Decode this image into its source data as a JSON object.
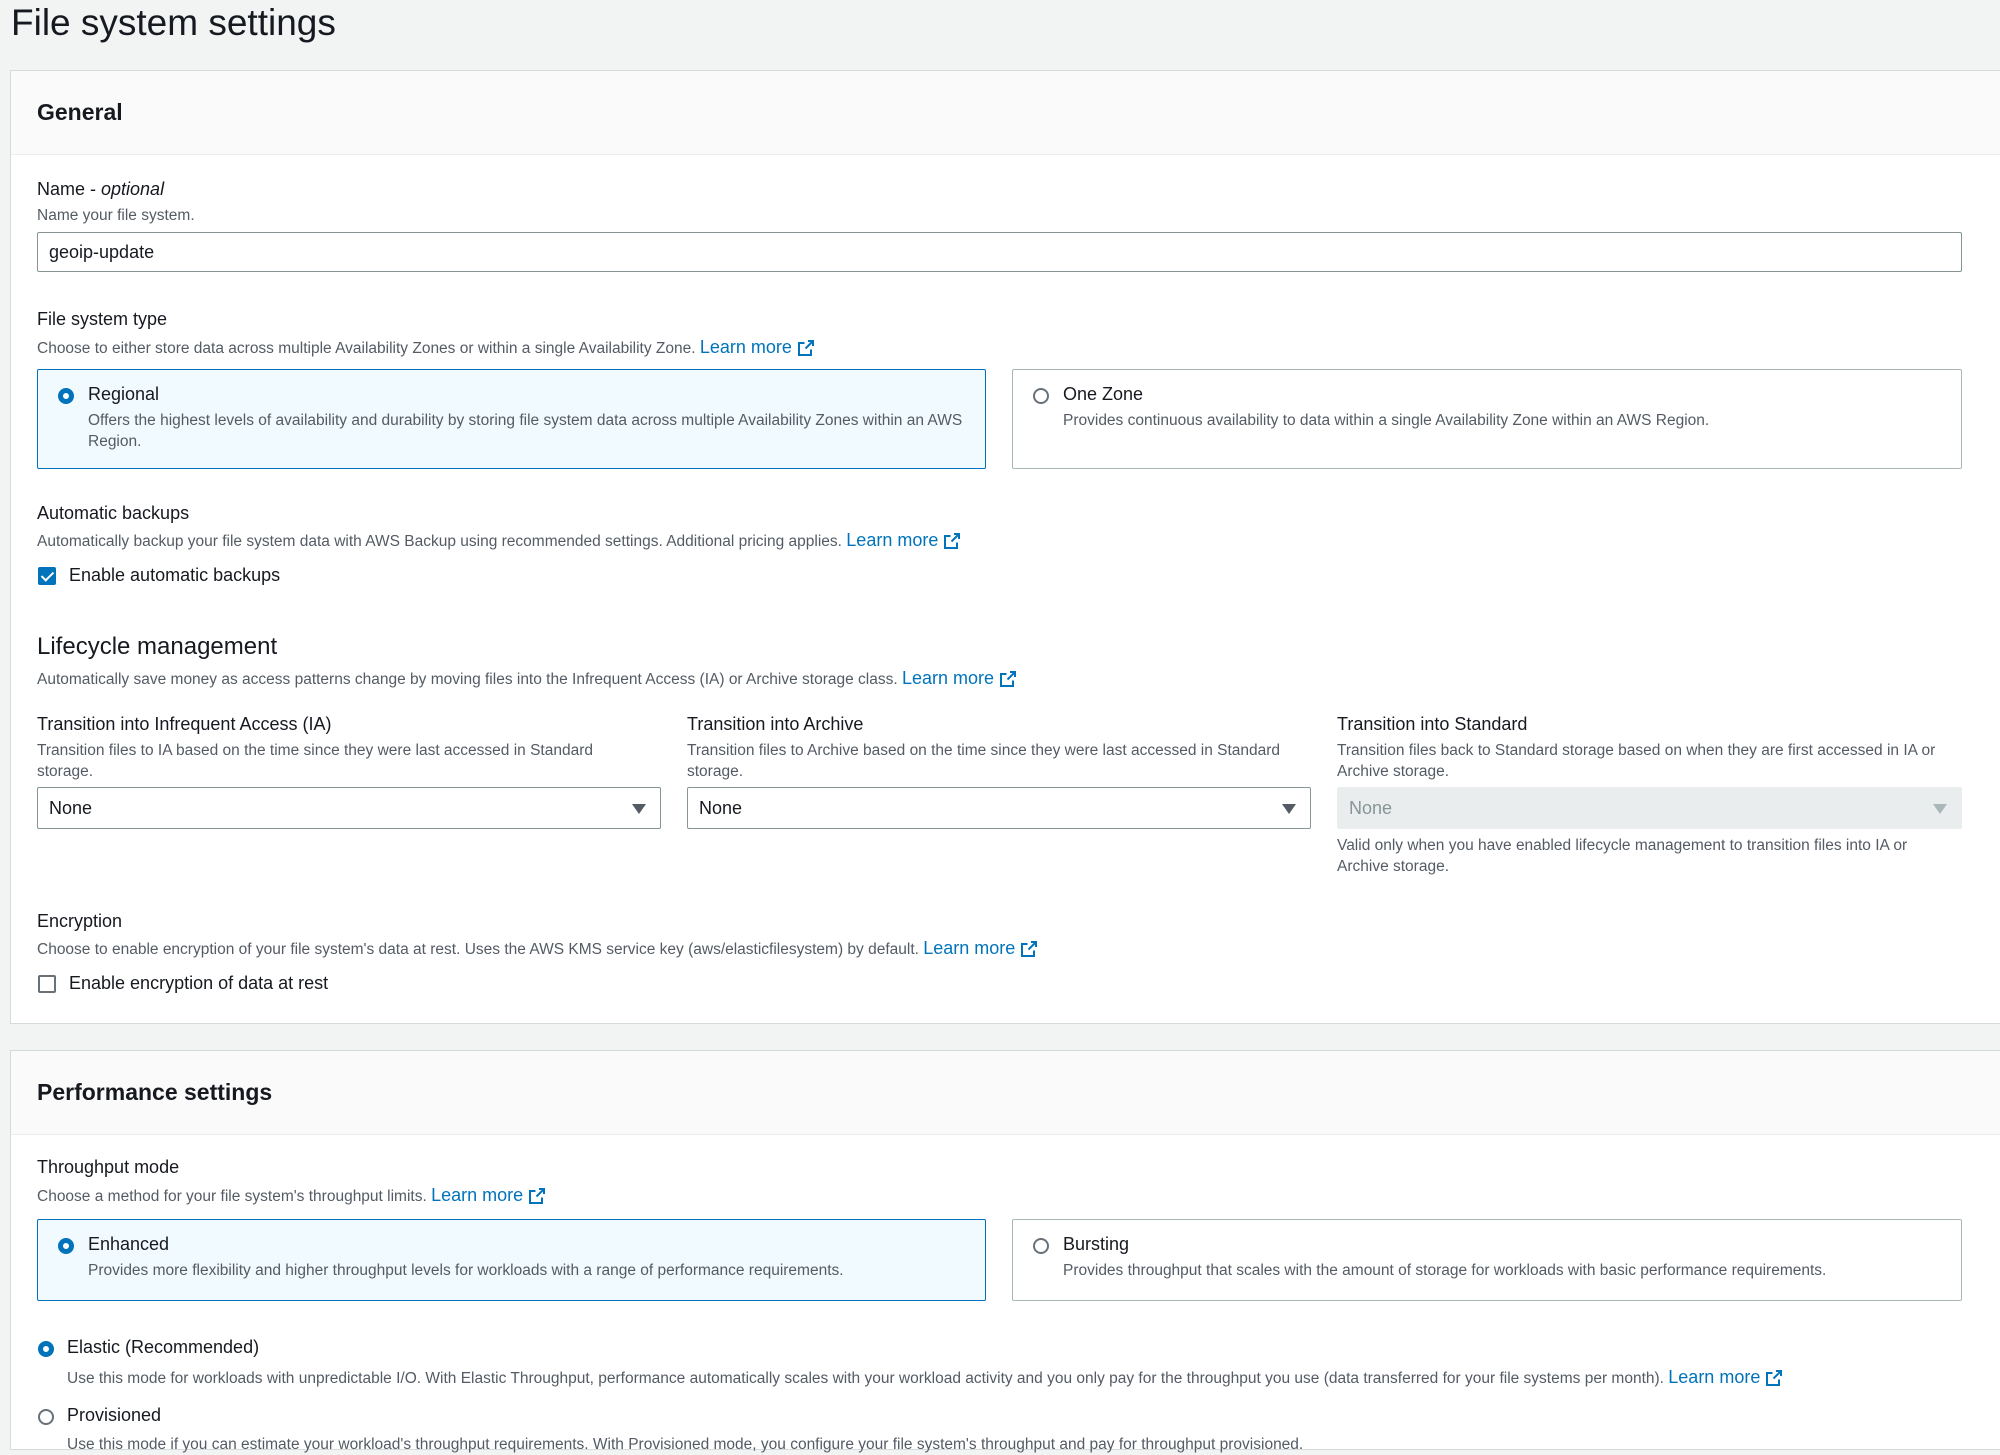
{
  "page_title": "File system settings",
  "general": {
    "heading": "General",
    "name": {
      "label": "Name - ",
      "label_optional": "optional",
      "description": "Name your file system.",
      "value": "geoip-update"
    },
    "fs_type": {
      "label": "File system type",
      "description": "Choose to either store data across multiple Availability Zones or within a single Availability Zone.",
      "learn_more": "Learn more",
      "options": [
        {
          "title": "Regional",
          "description": "Offers the highest levels of availability and durability by storing file system data across multiple Availability Zones within an AWS Region.",
          "selected": true
        },
        {
          "title": "One Zone",
          "description": "Provides continuous availability to data within a single Availability Zone within an AWS Region.",
          "selected": false
        }
      ]
    },
    "backups": {
      "label": "Automatic backups",
      "description": "Automatically backup your file system data with AWS Backup using recommended settings. Additional pricing applies.",
      "learn_more": "Learn more",
      "checkbox_label": "Enable automatic backups",
      "checked": true
    },
    "lifecycle": {
      "heading": "Lifecycle management",
      "description": "Automatically save money as access patterns change by moving files into the Infrequent Access (IA) or Archive storage class.",
      "learn_more": "Learn more",
      "ia": {
        "label": "Transition into Infrequent Access (IA)",
        "description": "Transition files to IA based on the time since they were last accessed in Standard storage.",
        "value": "None"
      },
      "archive": {
        "label": "Transition into Archive",
        "description": "Transition files to Archive based on the time since they were last accessed in Standard storage.",
        "value": "None"
      },
      "standard": {
        "label": "Transition into Standard",
        "description": "Transition files back to Standard storage based on when they are first accessed in IA or Archive storage.",
        "value": "None",
        "hint": "Valid only when you have enabled lifecycle management to transition files into IA or Archive storage."
      }
    },
    "encryption": {
      "label": "Encryption",
      "description": "Choose to enable encryption of your file system's data at rest. Uses the AWS KMS service key (aws/elasticfilesystem) by default.",
      "learn_more": "Learn more",
      "checkbox_label": "Enable encryption of data at rest",
      "checked": false
    }
  },
  "performance": {
    "heading": "Performance settings",
    "throughput": {
      "label": "Throughput mode",
      "description": "Choose a method for your file system's throughput limits.",
      "learn_more": "Learn more",
      "options": [
        {
          "title": "Enhanced",
          "description": "Provides more flexibility and higher throughput levels for workloads with a range of performance requirements.",
          "selected": true
        },
        {
          "title": "Bursting",
          "description": "Provides throughput that scales with the amount of storage for workloads with basic performance requirements.",
          "selected": false
        }
      ]
    },
    "elastic": {
      "label": "Elastic (Recommended)",
      "description": "Use this mode for workloads with unpredictable I/O. With Elastic Throughput, performance automatically scales with your workload activity and you only pay for the throughput you use (data transferred for your file systems per month).",
      "learn_more": "Learn more",
      "selected": true
    },
    "provisioned": {
      "label": "Provisioned",
      "description": "Use this mode if you can estimate your workload's throughput requirements. With Provisioned mode, you configure your file system's throughput and pay for throughput provisioned.",
      "selected": false
    }
  },
  "colors": {
    "accent": "#0073bb",
    "selected_bg": "#f1faff"
  }
}
